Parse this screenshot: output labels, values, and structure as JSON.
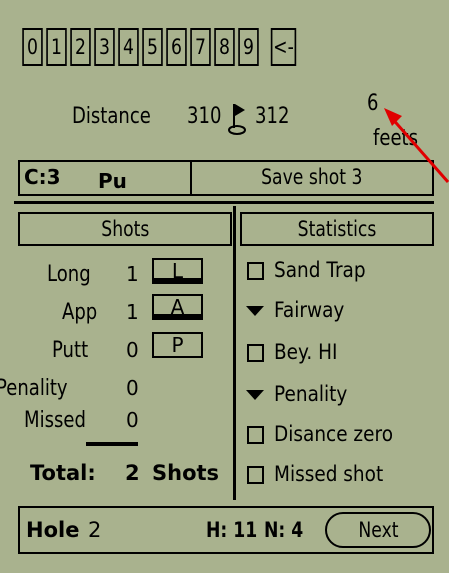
{
  "keypad": {
    "digits": [
      "0",
      "1",
      "2",
      "3",
      "4",
      "5",
      "6",
      "7",
      "8",
      "9"
    ],
    "backspace": "<-"
  },
  "distance": {
    "label": "Distance",
    "from": "310",
    "to": "312",
    "remaining": "6",
    "unit": "feets"
  },
  "club": {
    "code": "C:3",
    "name": "Pu"
  },
  "save_button": "Save shot 3",
  "headers": {
    "shots": "Shots",
    "statistics": "Statistics"
  },
  "shots": [
    {
      "label": "Long",
      "count": "1",
      "button": "L"
    },
    {
      "label": "App",
      "count": "1",
      "button": "A"
    },
    {
      "label": "Putt",
      "count": "0",
      "button": "P"
    },
    {
      "label": "Penality",
      "count": "0"
    },
    {
      "label": "Missed",
      "count": "0"
    }
  ],
  "total": {
    "label": "Total:",
    "count": "2",
    "unit": "Shots"
  },
  "statistics": [
    {
      "type": "checkbox",
      "label": "Sand Trap",
      "checked": false
    },
    {
      "type": "dropdown",
      "label": "Fairway"
    },
    {
      "type": "checkbox",
      "label": "Bey. HI",
      "checked": false
    },
    {
      "type": "dropdown",
      "label": "Penality"
    },
    {
      "type": "checkbox",
      "label": "Disance zero",
      "checked": false
    },
    {
      "type": "checkbox",
      "label": "Missed shot",
      "checked": false
    }
  ],
  "footer": {
    "hole_label": "Hole",
    "hole_number": "2",
    "handicap": "H: 11",
    "par": "N: 4",
    "next_button": "Next"
  },
  "colors": {
    "lcd_background": "#a9b28e",
    "ink": "#000000",
    "annotation_arrow": "#e00000"
  },
  "icons": {
    "flag": "golf-flag-icon",
    "arrow": "annotation-arrow-icon"
  }
}
